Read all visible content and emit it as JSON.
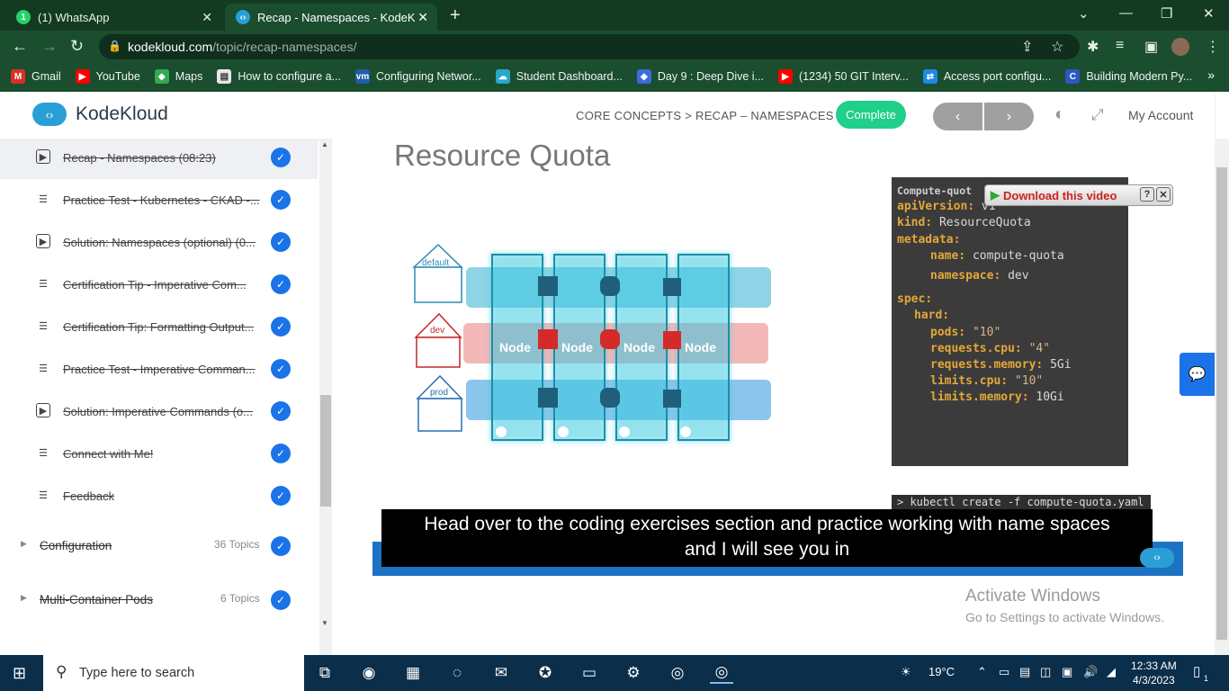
{
  "browser": {
    "tabs": [
      {
        "label": "(1) WhatsApp",
        "icon": "whatsapp-icon"
      },
      {
        "label": "Recap - Namespaces - KodeKlou",
        "icon": "kodekloud-icon"
      }
    ],
    "url_host": "kodekloud.com",
    "url_path": "/topic/recap-namespaces/",
    "bookmarks": [
      {
        "label": "Gmail",
        "icon": "gmail-icon",
        "color": "#d93025"
      },
      {
        "label": "YouTube",
        "icon": "youtube-icon",
        "color": "#ff0000"
      },
      {
        "label": "Maps",
        "icon": "maps-icon",
        "color": "#34a853"
      },
      {
        "label": "How to configure a...",
        "icon": "page-icon",
        "color": "#e8e8e8"
      },
      {
        "label": "Configuring Networ...",
        "icon": "vmware-icon",
        "color": "#1d5fa8"
      },
      {
        "label": "Student Dashboard...",
        "icon": "cloud-icon",
        "color": "#2aa6c9"
      },
      {
        "label": "Day 9 : Deep Dive i...",
        "icon": "diamond-icon",
        "color": "#3b6bdc"
      },
      {
        "label": "(1234) 50 GIT Interv...",
        "icon": "youtube-icon",
        "color": "#ff0000"
      },
      {
        "label": "Access port configu...",
        "icon": "network-icon",
        "color": "#1e88e5"
      },
      {
        "label": "Building Modern Py...",
        "icon": "c-icon",
        "color": "#2b59c3"
      }
    ]
  },
  "header": {
    "logo_text": "KodeKloud",
    "breadcrumb": "CORE CONCEPTS > RECAP – NAMESPACES",
    "complete_label": "Complete",
    "prev_label": "‹",
    "next_label": "›",
    "account_label": "My Account"
  },
  "sidebar": {
    "lessons": [
      {
        "label": "Recap - Namespaces (08:23)",
        "type": "video",
        "current": true
      },
      {
        "label": "Practice Test - Kubernetes - CKAD -...",
        "type": "text"
      },
      {
        "label": "Solution: Namespaces (optional) (0...",
        "type": "video"
      },
      {
        "label": "Certification Tip - Imperative Com...",
        "type": "text"
      },
      {
        "label": "Certification Tip: Formatting Output...",
        "type": "text"
      },
      {
        "label": "Practice Test - Imperative Comman...",
        "type": "text"
      },
      {
        "label": "Solution: Imperative Commands (o...",
        "type": "video"
      },
      {
        "label": "Connect with Me!",
        "type": "text"
      },
      {
        "label": "Feedback",
        "type": "text"
      }
    ],
    "sections": [
      {
        "label": "Configuration",
        "count": "36 Topics"
      },
      {
        "label": "Multi-Container Pods",
        "count": "6 Topics"
      }
    ]
  },
  "slide": {
    "title": "Resource Quota",
    "namespaces": [
      "default",
      "dev",
      "prod"
    ],
    "node_label": "Node",
    "yaml_header": "Compute-quot",
    "yaml": {
      "apiVersion_key": "apiVersion:",
      "apiVersion_val": "v1",
      "kind_key": "kind:",
      "kind_val": "ResourceQuota",
      "metadata_key": "metadata:",
      "name_key": "name:",
      "name_val": "compute-quota",
      "namespace_key": "namespace:",
      "namespace_val": "dev",
      "spec_key": "spec:",
      "hard_key": "hard:",
      "pods_key": "pods:",
      "pods_val": "\"10\"",
      "rcpu_key": "requests.cpu:",
      "rcpu_val": "\"4\"",
      "rmem_key": "requests.memory:",
      "rmem_val": "5Gi",
      "lcpu_key": "limits.cpu:",
      "lcpu_val": "\"10\"",
      "lmem_key": "limits.memory:",
      "lmem_val": "10Gi"
    },
    "command": "> kubectl create -f compute-quota.yaml",
    "download_label": "Download this video"
  },
  "caption": {
    "line1": "Head over to the coding exercises section and practice working with name spaces",
    "line2": "and I will see you in"
  },
  "watermark": {
    "line1": "Activate Windows",
    "line2": "Go to Settings to activate Windows."
  },
  "taskbar": {
    "search_placeholder": "Type here to search",
    "weather": "19°C",
    "time": "12:33 AM",
    "date": "4/3/2023",
    "notification_count": "1"
  }
}
